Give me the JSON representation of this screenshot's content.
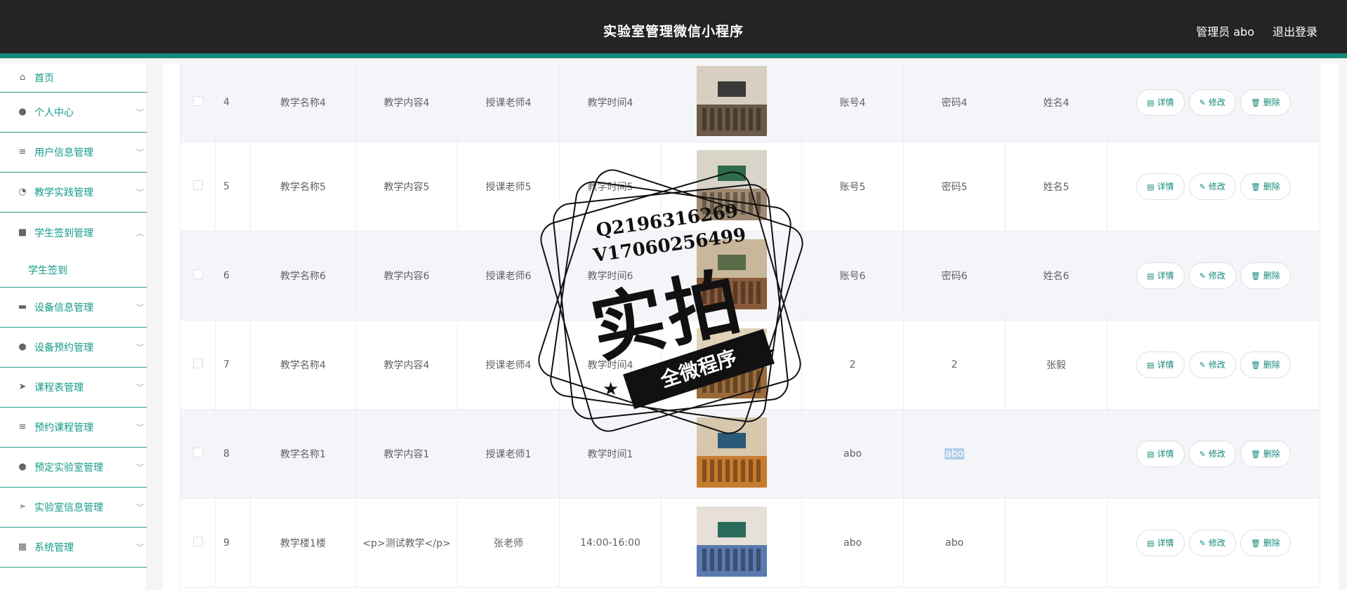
{
  "header": {
    "title": "实验室管理微信小程序",
    "user": "管理员 abo",
    "logout": "退出登录"
  },
  "sidebar": {
    "items": [
      {
        "label": "首页",
        "icon": "home-icon",
        "glyph": "⌂",
        "chevron": ""
      },
      {
        "label": "个人中心",
        "icon": "person-icon",
        "glyph": "●",
        "chevron": "﹀"
      },
      {
        "label": "用户信息管理",
        "icon": "list-icon",
        "glyph": "≡",
        "chevron": "﹀"
      },
      {
        "label": "教学实践管理",
        "icon": "gauge-icon",
        "glyph": "◔",
        "chevron": "﹀"
      },
      {
        "label": "学生签到管理",
        "icon": "box-icon",
        "glyph": "■",
        "chevron": "︿"
      },
      {
        "label": "设备信息管理",
        "icon": "chat-icon",
        "glyph": "▬",
        "chevron": "﹀"
      },
      {
        "label": "设备预约管理",
        "icon": "person-icon",
        "glyph": "●",
        "chevron": "﹀"
      },
      {
        "label": "课程表管理",
        "icon": "send-icon",
        "glyph": "➤",
        "chevron": "﹀"
      },
      {
        "label": "预约课程管理",
        "icon": "list-icon",
        "glyph": "≡",
        "chevron": "﹀"
      },
      {
        "label": "预定实验室管理",
        "icon": "person-icon",
        "glyph": "●",
        "chevron": "﹀"
      },
      {
        "label": "实验室信息管理",
        "icon": "navigate-icon",
        "glyph": "➣",
        "chevron": "﹀"
      },
      {
        "label": "系统管理",
        "icon": "grid-icon",
        "glyph": "▦",
        "chevron": "﹀"
      }
    ],
    "submenu_label": "学生签到"
  },
  "table": {
    "rows": [
      {
        "idx": "4",
        "name": "教学名称4",
        "content": "教学内容4",
        "teacher": "授课老师4",
        "time": "教学时间4",
        "account": "账号4",
        "password": "密码4",
        "realname": "姓名4"
      },
      {
        "idx": "5",
        "name": "教学名称5",
        "content": "教学内容5",
        "teacher": "授课老师5",
        "time": "教学时间5",
        "account": "账号5",
        "password": "密码5",
        "realname": "姓名5"
      },
      {
        "idx": "6",
        "name": "教学名称6",
        "content": "教学内容6",
        "teacher": "授课老师6",
        "time": "教学时间6",
        "account": "账号6",
        "password": "密码6",
        "realname": "姓名6"
      },
      {
        "idx": "7",
        "name": "教学名称4",
        "content": "教学内容4",
        "teacher": "授课老师4",
        "time": "教学时间4",
        "account": "2",
        "password": "2",
        "realname": "张毅"
      },
      {
        "idx": "8",
        "name": "教学名称1",
        "content": "教学内容1",
        "teacher": "授课老师1",
        "time": "教学时间1",
        "account": "abo",
        "password": "abo",
        "realname": ""
      },
      {
        "idx": "9",
        "name": "教学楼1楼",
        "content": "<p>测试教学</p>",
        "teacher": "张老师",
        "time": "14:00-16:00",
        "account": "abo",
        "password": "abo",
        "realname": ""
      }
    ],
    "actions": {
      "detail": "详情",
      "edit": "修改",
      "delete": "删除"
    }
  },
  "watermark": {
    "line1": "Q2196316269",
    "line2": "V17060256499",
    "big": "实拍",
    "ribbon": "全微程序"
  },
  "colors": {
    "accent": "#13897a",
    "header_bg": "#242424",
    "stripe": "#f4f5f8"
  }
}
